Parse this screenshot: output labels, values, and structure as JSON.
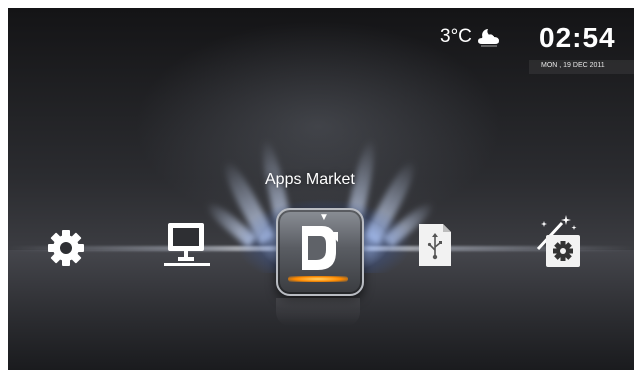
{
  "status": {
    "temperature": "3°C",
    "weather_icon": "cloudy-night-icon",
    "time": "02:54",
    "date": "MON , 19 DEC 2011"
  },
  "menu": {
    "selected_label": "Apps Market",
    "items": [
      {
        "icon": "settings-gear-icon"
      },
      {
        "icon": "network-computer-icon"
      },
      {
        "icon": "apps-market-icon",
        "selected": true
      },
      {
        "icon": "usb-storage-icon"
      },
      {
        "icon": "setup-wizard-icon"
      }
    ]
  },
  "colors": {
    "background": "#2b2c30",
    "glow": "#cfe0ff",
    "accent": "#ff8a00"
  }
}
